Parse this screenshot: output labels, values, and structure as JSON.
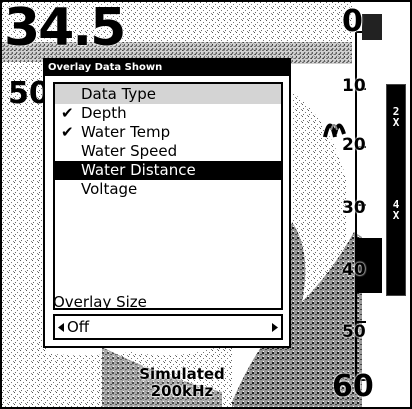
{
  "readouts": {
    "depth": "34.5",
    "water_temp": "50"
  },
  "scale": {
    "labels": [
      "0",
      "10",
      "20",
      "30",
      "40",
      "50",
      "60"
    ]
  },
  "zoom": {
    "btn_2x": "2\nX",
    "btn_4x": "4\nX"
  },
  "sonar_status": {
    "line1": "Simulated",
    "line2": "200kHz"
  },
  "dialog": {
    "title": "Overlay Data Shown",
    "list_header": "Data Type",
    "items": [
      {
        "label": "Depth",
        "checked": true,
        "selected": false
      },
      {
        "label": "Water Temp",
        "checked": true,
        "selected": false
      },
      {
        "label": "Water Speed",
        "checked": false,
        "selected": false
      },
      {
        "label": "Water Distance",
        "checked": false,
        "selected": true
      },
      {
        "label": "Voltage",
        "checked": false,
        "selected": false
      }
    ],
    "size_label": "Overlay Size",
    "size_value": "Off"
  },
  "icons": {
    "check": "check-icon",
    "left_arrow": "triangle-left-icon",
    "right_arrow": "triangle-right-icon"
  }
}
